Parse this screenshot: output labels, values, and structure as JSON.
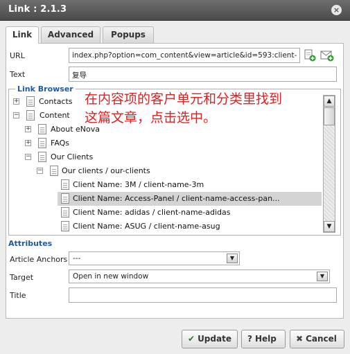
{
  "window": {
    "title": "Link : 2.1.3",
    "close_glyph": "×"
  },
  "tabs": [
    {
      "label": "Link"
    },
    {
      "label": "Advanced"
    },
    {
      "label": "Popups"
    }
  ],
  "form": {
    "url_label": "URL",
    "url_value": "index.php?option=com_content&view=article&id=593:client-",
    "text_label": "Text",
    "text_value": "复导"
  },
  "link_browser": {
    "legend": "Link Browser",
    "overlay_text_line1": "在内容项的客户单元和分类里找到",
    "overlay_text_line2": "这篇文章，点击选中。",
    "tree": [
      {
        "label": "Contacts",
        "toggle": "+"
      },
      {
        "label": "Content",
        "toggle": "−"
      },
      {
        "label": "About eNova",
        "toggle": "+"
      },
      {
        "label": "FAQs",
        "toggle": "+"
      },
      {
        "label": "Our Clients",
        "toggle": "−"
      },
      {
        "label": "Our clients / our-clients",
        "toggle": "−"
      },
      {
        "label": "Client Name: 3M / client-name-3m"
      },
      {
        "label": "Client Name: Access-Panel / client-name-access-pan..."
      },
      {
        "label": "Client Name: adidas / client-name-adidas"
      },
      {
        "label": "Client Name: ASUG / client-name-asug"
      }
    ],
    "selected_index": 7
  },
  "attributes": {
    "heading": "Attributes",
    "anchors_label": "Article Anchors",
    "anchors_value": "---",
    "target_label": "Target",
    "target_value": "Open in new window",
    "title_label": "Title",
    "title_value": ""
  },
  "buttons": {
    "update": "Update",
    "help": "Help",
    "cancel": "Cancel",
    "update_icon": "✔",
    "help_icon": "?",
    "cancel_icon": "✖"
  },
  "colors": {
    "accent": "#1c5aa8",
    "overlay_text": "#e02020",
    "selected_row": "#d4d4d4"
  }
}
